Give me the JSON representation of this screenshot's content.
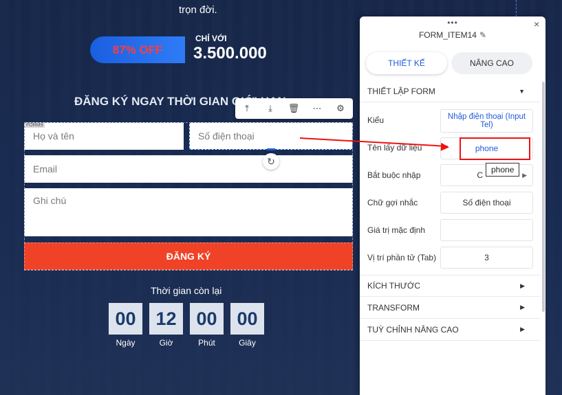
{
  "landing": {
    "top_text": "trọn đời.",
    "badge": "87% OFF",
    "price_label": "CHỈ VỚI",
    "price_value": "3.500.000",
    "register_title": "ĐĂNG KÝ NGAY THỜI GIAN GIỚI HẠN",
    "form_tag": "FORM9",
    "fields": {
      "name_placeholder": "Họ và tên",
      "phone_placeholder": "Số điện thoại",
      "email_placeholder": "Email",
      "note_placeholder": "Ghi chú"
    },
    "submit_label": "ĐĂNG KÝ",
    "countdown": {
      "label": "Thời gian còn lại",
      "items": [
        {
          "value": "00",
          "unit": "Ngày"
        },
        {
          "value": "12",
          "unit": "Giờ"
        },
        {
          "value": "00",
          "unit": "Phút"
        },
        {
          "value": "00",
          "unit": "Giây"
        }
      ]
    }
  },
  "toolbar": {
    "icons": [
      "move-up-icon",
      "move-down-icon",
      "trash-icon",
      "more-icon",
      "gear-icon"
    ],
    "glyphs": [
      "⤒",
      "⤓",
      "🗑",
      "⋯",
      "⚙"
    ]
  },
  "panel": {
    "drag_glyph": "•••",
    "title": "FORM_ITEM14",
    "close_glyph": "×",
    "tabs": {
      "design": "THIẾT KẾ",
      "advanced": "NÂNG CAO"
    },
    "sections": {
      "form_setup": "THIẾT LẬP FORM",
      "size": "KÍCH THƯỚC",
      "transform": "TRANSFORM",
      "advanced": "TUỲ CHỈNH NÂNG CAO"
    },
    "rows": {
      "type": {
        "label": "Kiểu",
        "value": "Nhập điện thoại (Input Tel)"
      },
      "data_name": {
        "label": "Tên lấy dữ liệu",
        "value": "phone"
      },
      "required": {
        "label": "Bắt buộc nhập",
        "value": "C"
      },
      "placeholder": {
        "label": "Chữ gợi nhắc",
        "value": "Số điện thoại"
      },
      "default": {
        "label": "Giá trị mặc định",
        "value": ""
      },
      "tab_index": {
        "label": "Vị trí phần tử (Tab)",
        "value": "3"
      }
    },
    "tooltip": "phone"
  },
  "colors": {
    "accent": "#1f5bd6",
    "submit": "#f04227",
    "annotation": "#e11111"
  }
}
